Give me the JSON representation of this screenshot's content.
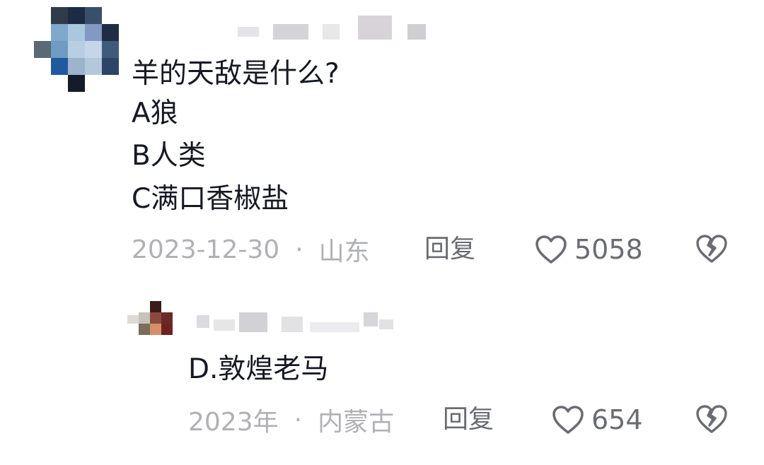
{
  "comment": {
    "lines": [
      "羊的天敌是什么?",
      "A狼",
      "B人类",
      "C满口香椒盐"
    ],
    "date": "2023-12-30",
    "separator": "·",
    "location": "山东",
    "reply_label": "回复",
    "likes": "5058",
    "icons": {
      "like": "heart-outline-icon",
      "dislike": "broken-heart-icon"
    }
  },
  "reply": {
    "text": "D.敦煌老马",
    "date": "2023年",
    "separator": "·",
    "location": "内蒙古",
    "reply_label": "回复",
    "likes": "654",
    "icons": {
      "like": "heart-outline-icon",
      "dislike": "broken-heart-icon"
    }
  },
  "colors": {
    "text": "#161823",
    "meta": "#b0b1b6",
    "action": "#6b6c73"
  }
}
